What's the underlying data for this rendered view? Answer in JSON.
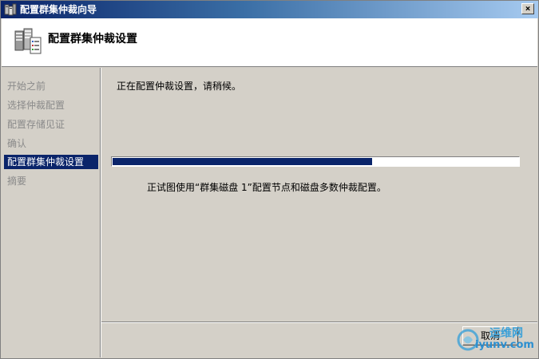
{
  "window": {
    "title": "配置群集仲裁向导",
    "close_glyph": "×"
  },
  "header": {
    "title": "配置群集仲裁设置",
    "icon": "cluster-servers-icon"
  },
  "sidebar": {
    "steps": [
      {
        "label": "开始之前",
        "active": false
      },
      {
        "label": "选择仲裁配置",
        "active": false
      },
      {
        "label": "配置存储见证",
        "active": false
      },
      {
        "label": "确认",
        "active": false
      },
      {
        "label": "配置群集仲裁设置",
        "active": true
      },
      {
        "label": "摘要",
        "active": false
      }
    ]
  },
  "main": {
    "status_text": "正在配置仲裁设置，请稍候。",
    "progress": 0.64,
    "detail_text": "正试图使用“群集磁盘 1”配置节点和磁盘多数仲裁配置。"
  },
  "footer": {
    "cancel_label": "取消"
  },
  "watermark": {
    "line1": "运维网",
    "line2": "iyunv.com"
  },
  "colors": {
    "accent": "#0a246a",
    "face": "#d4d0c8"
  }
}
